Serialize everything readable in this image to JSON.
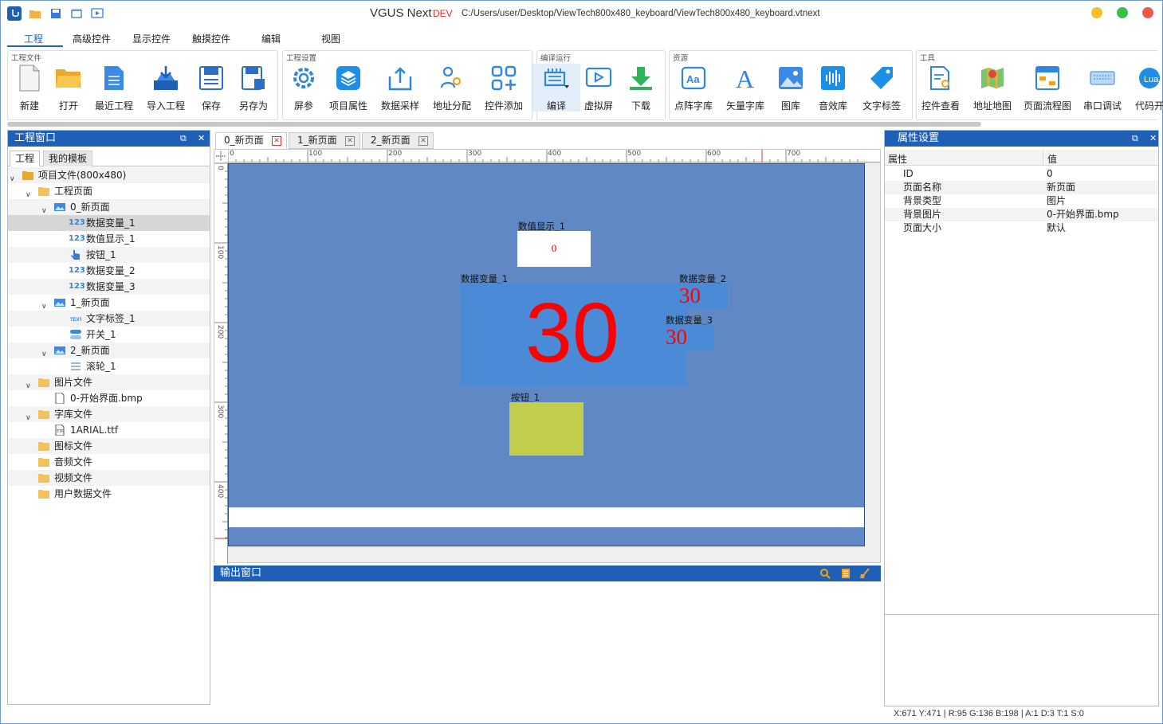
{
  "title": {
    "app": "VGUS Next",
    "dev": "DEV",
    "path": "C:/Users/user/Desktop/ViewTech800x480_keyboard/ViewTech800x480_keyboard.vtnext"
  },
  "menu": [
    "工程",
    "高级控件",
    "显示控件",
    "触摸控件",
    "编辑",
    "视图"
  ],
  "ribbon": {
    "groups": {
      "file": "工程文件",
      "settings": "工程设置",
      "compile": "编译运行",
      "resource": "资源",
      "tools": "工具"
    },
    "buttons": {
      "new": "新建",
      "open": "打开",
      "recent": "最近工程",
      "import": "导入工程",
      "save": "保存",
      "saveas": "另存为",
      "screen": "屏参",
      "props": "项目属性",
      "sampling": "数据采样",
      "address": "地址分配",
      "addctrl": "控件添加",
      "compile": "编译",
      "virtual": "虚拟屏",
      "download": "下载",
      "dotfont": "点阵字库",
      "vecfont": "矢量字库",
      "imglib": "图库",
      "audiolib": "音效库",
      "textlabel": "文字标签",
      "ctrlview": "控件查看",
      "addrmap": "地址地图",
      "flow": "页面流程图",
      "serial": "串口调试",
      "code": "代码开"
    }
  },
  "left_panel": {
    "title": "工程窗口",
    "tabs": [
      "工程",
      "我的模板"
    ],
    "tree": {
      "root": "项目文件(800x480)",
      "pages": "工程页面",
      "p0": "0_新页面",
      "p0_c1": "数据变量_1",
      "p0_c2": "数值显示_1",
      "p0_c3": "按钮_1",
      "p0_c4": "数据变量_2",
      "p0_c5": "数据变量_3",
      "p1": "1_新页面",
      "p1_c1": "文字标签_1",
      "p1_c2": "开关_1",
      "p2": "2_新页面",
      "p2_c1": "滚轮_1",
      "images": "图片文件",
      "image1": "0-开始界面.bmp",
      "fonts": "字库文件",
      "font1": "1ARIAL.ttf",
      "icons": "图标文件",
      "audio": "音频文件",
      "video": "视频文件",
      "userdata": "用户数据文件"
    }
  },
  "doc_tabs": [
    "0_新页面",
    "1_新页面",
    "2_新页面"
  ],
  "ruler": {
    "top": [
      "0",
      "100",
      "200",
      "300",
      "400",
      "500",
      "600",
      "700"
    ],
    "left": [
      "0",
      "100",
      "200",
      "300",
      "400"
    ]
  },
  "canvas": {
    "num_display_label": "数值显示_1",
    "num_display_value": "0",
    "var1_label": "数据变量_1",
    "var1_value": "30",
    "var2_label": "数据变量_2",
    "var2_value": "30",
    "var3_label": "数据变量_3",
    "var3_value": "30",
    "button_label": "按钮_1"
  },
  "output": {
    "title": "输出窗口"
  },
  "right_panel": {
    "title": "属性设置",
    "header": {
      "prop": "属性",
      "value": "值"
    },
    "rows": [
      {
        "k": "ID",
        "v": "0"
      },
      {
        "k": "页面名称",
        "v": "新页面"
      },
      {
        "k": "背景类型",
        "v": "图片"
      },
      {
        "k": "背景图片",
        "v": "0-开始界面.bmp"
      },
      {
        "k": "页面大小",
        "v": "默认"
      }
    ]
  },
  "status": "X:671  Y:471  |  R:95 G:136 B:198  |  A:1  D:3  T:1  S:0",
  "colors": {
    "accent": "#1f5fb5",
    "page_bg": "#5f88c5",
    "var_bg": "#4a8ad6",
    "digit_red": "#ff0000",
    "button_fill": "#c2cd4e"
  }
}
